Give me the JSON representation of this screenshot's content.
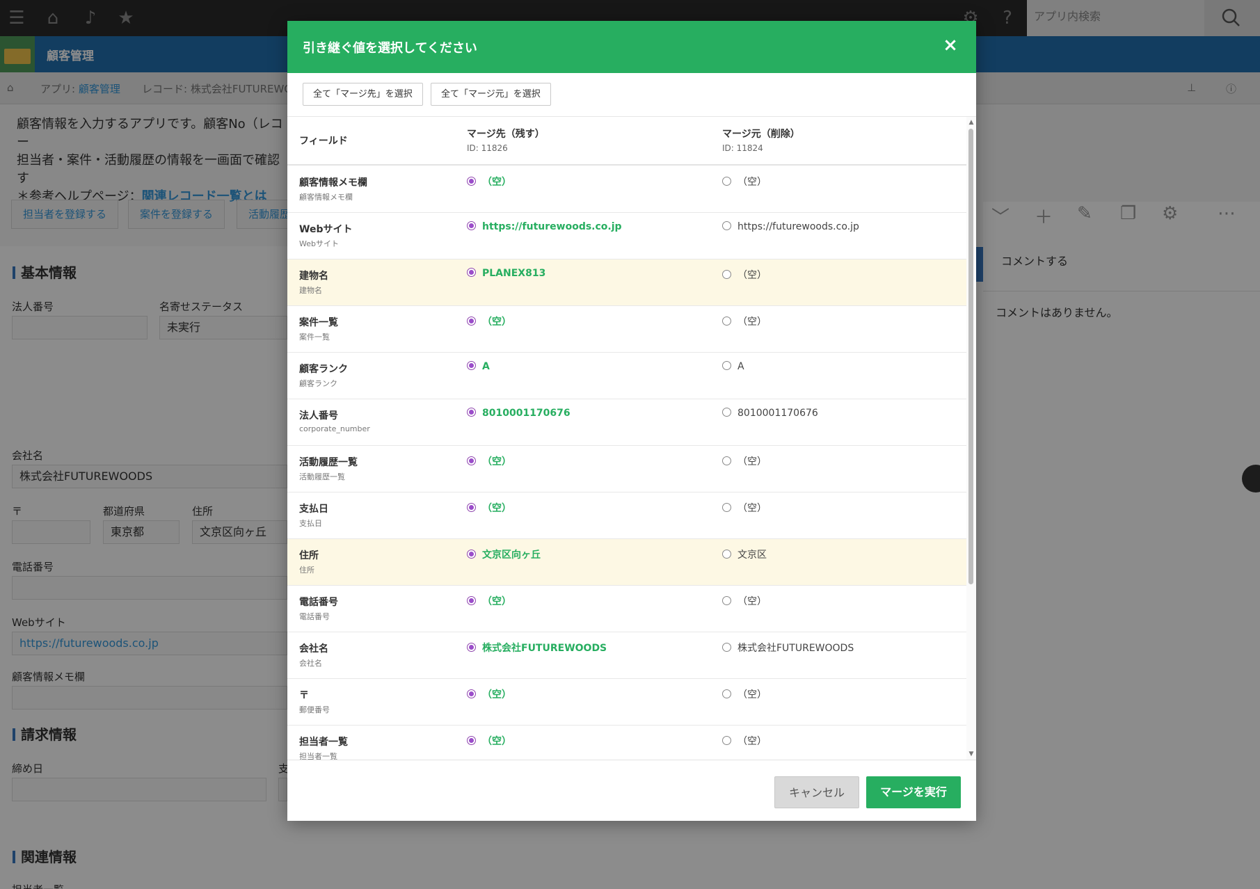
{
  "topbar": {
    "icons": [
      "menu-icon",
      "home-icon",
      "bell-icon",
      "star-icon",
      "gear-icon",
      "help-icon",
      "search-icon"
    ],
    "search_placeholder": "アプリ内検索"
  },
  "app": {
    "name": "顧客管理"
  },
  "breadcrumb": {
    "app_prefix": "アプリ: ",
    "app_link": "顧客管理",
    "record": "レコード: 株式会社FUTUREWOODS"
  },
  "description": {
    "line1": "顧客情報を入力するアプリです。顧客No（レコー",
    "line2": "担当者・案件・活動履歴の情報を一画面で確認す",
    "line3_prefix": "＊参考ヘルプページ：",
    "line3_link": "関連レコード一覧とは"
  },
  "actions": [
    "担当者を登録する",
    "案件を登録する",
    "活動履歴"
  ],
  "form": {
    "section_basic": "基本情報",
    "corp_number_label": "法人番号",
    "dedupe_status_label": "名寄せステータス",
    "dedupe_status_value": "未実行",
    "company_label": "会社名",
    "company_value": "株式会社FUTUREWOODS",
    "postal_label": "〒",
    "prefecture_label": "都道府県",
    "prefecture_value": "東京都",
    "address_label": "住所",
    "address_value": "文京区向ヶ丘",
    "phone_label": "電話番号",
    "website_label": "Webサイト",
    "website_value": "https://futurewoods.co.jp",
    "memo_label": "顧客情報メモ欄",
    "section_billing": "請求情報",
    "closing_label": "締め日",
    "pay_label": "支",
    "section_related": "関連情報",
    "assignee_label": "担当者一覧"
  },
  "sidebar": {
    "comment_label": "コメントする",
    "no_comments": "コメントはありません。"
  },
  "modal": {
    "title": "引き継ぐ値を選択してください",
    "close": "×",
    "select_all_target": "全て「マージ先」を選択",
    "select_all_source": "全て「マージ元」を選択",
    "col_field": "フィールド",
    "col_target": "マージ先（残す）",
    "col_target_id": "ID: 11826",
    "col_source": "マージ元（削除）",
    "col_source_id": "ID: 11824",
    "rows": [
      {
        "name": "顧客情報メモ欄",
        "code": "顧客情報メモ欄",
        "target": "（空）",
        "source": "（空）",
        "highlight": false
      },
      {
        "name": "Webサイト",
        "code": "Webサイト",
        "target": "https://futurewoods.co.jp",
        "source": "https://futurewoods.co.jp",
        "highlight": false
      },
      {
        "name": "建物名",
        "code": "建物名",
        "target": "PLANEX813",
        "source": "（空）",
        "highlight": true
      },
      {
        "name": "案件一覧",
        "code": "案件一覧",
        "target": "（空）",
        "source": "（空）",
        "highlight": false
      },
      {
        "name": "顧客ランク",
        "code": "顧客ランク",
        "target": "A",
        "source": "A",
        "highlight": false
      },
      {
        "name": "法人番号",
        "code": "corporate_number",
        "target": "8010001170676",
        "source": "8010001170676",
        "highlight": false
      },
      {
        "name": "活動履歴一覧",
        "code": "活動履歴一覧",
        "target": "（空）",
        "source": "（空）",
        "highlight": false
      },
      {
        "name": "支払日",
        "code": "支払日",
        "target": "（空）",
        "source": "（空）",
        "highlight": false
      },
      {
        "name": "住所",
        "code": "住所",
        "target": "文京区向ヶ丘",
        "source": "文京区",
        "highlight": true
      },
      {
        "name": "電話番号",
        "code": "電話番号",
        "target": "（空）",
        "source": "（空）",
        "highlight": false
      },
      {
        "name": "会社名",
        "code": "会社名",
        "target": "株式会社FUTUREWOODS",
        "source": "株式会社FUTUREWOODS",
        "highlight": false
      },
      {
        "name": "〒",
        "code": "郵便番号",
        "target": "（空）",
        "source": "（空）",
        "highlight": false
      },
      {
        "name": "担当者一覧",
        "code": "担当者一覧",
        "target": "（空）",
        "source": "（空）",
        "highlight": false
      }
    ],
    "cancel": "キャンセル",
    "execute": "マージを実行"
  },
  "colors": {
    "header_green": "#27ae60",
    "app_blue": "#216fb0",
    "radio_purple": "#9b4dca",
    "highlight_row": "#fdf8e4",
    "link_blue": "#3498db"
  }
}
